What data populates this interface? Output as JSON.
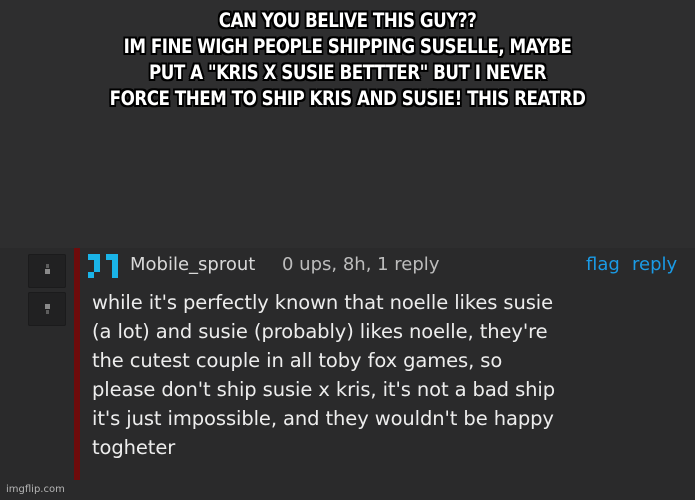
{
  "caption": {
    "lines": [
      "CAN YOU BELIVE THIS GUY??",
      "IM FINE WIGH PEOPLE SHIPPING SUSELLE, MAYBE",
      "PUT A \"KRIS X SUSIE BETTTER\" BUT I NEVER",
      "FORCE THEM TO SHIP KRIS AND SUSIE! THIS REATRD"
    ]
  },
  "comment": {
    "avatar_icon": "pixel-avatar-icon",
    "username": "Mobile_sprout",
    "meta": "0 ups, 8h, 1 reply",
    "flag_label": "flag",
    "reply_label": "reply",
    "body_lines": [
      "while it's perfectly known that noelle likes susie",
      "(a lot) and susie (probably) likes noelle, they're",
      "the cutest couple in all toby fox games, so",
      "please don't ship susie x kris, it's not a bad ship",
      "it's just impossible, and they wouldn't be happy",
      "togheter"
    ],
    "upvote_icon": "upvote-icon",
    "downvote_icon": "downvote-icon"
  },
  "watermark": "imgflip.com",
  "colors": {
    "caption_text": "#ffffff",
    "background": "#2e2e2f",
    "link": "#1a9be6",
    "thread_line": "#6e0b0b",
    "avatar": "#1ab4e8"
  }
}
